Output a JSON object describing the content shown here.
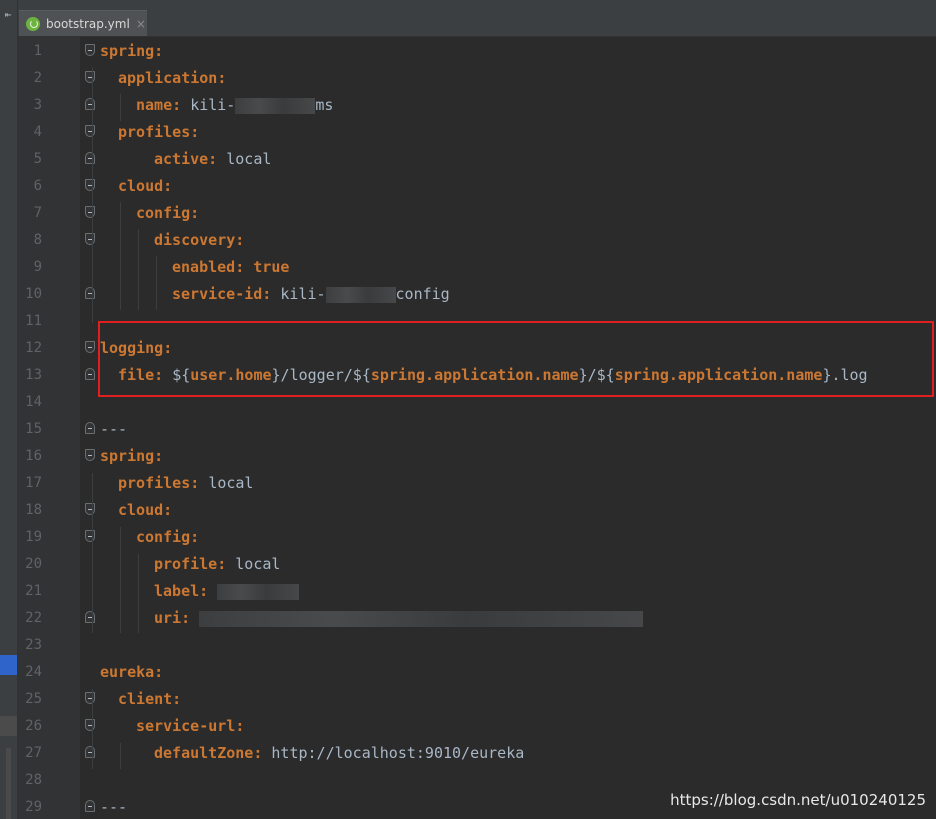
{
  "tab": {
    "filename": "bootstrap.yml",
    "close_glyph": "×",
    "icon": "spring-leaf-icon",
    "nav_glyph": "⇤"
  },
  "line_numbers": [
    "1",
    "2",
    "3",
    "4",
    "5",
    "6",
    "7",
    "8",
    "9",
    "10",
    "11",
    "12",
    "13",
    "14",
    "15",
    "16",
    "17",
    "18",
    "19",
    "20",
    "21",
    "22",
    "23",
    "24",
    "25",
    "26",
    "27",
    "28",
    "29"
  ],
  "code": {
    "l1_key": "spring:",
    "l2_key": "application:",
    "l3_key": "name:",
    "l3_val_a": "kili-",
    "l3_val_b": "ms",
    "l4_key": "profiles:",
    "l5_key": "active:",
    "l5_val": "local",
    "l6_key": "cloud:",
    "l7_key": "config:",
    "l8_key": "discovery:",
    "l9_key": "enabled:",
    "l9_val": "true",
    "l10_key": "service-id:",
    "l10_val_a": "kili-",
    "l10_val_b": "config",
    "l12_key": "logging:",
    "l13_key": "file:",
    "l13_p1": "${",
    "l13_v1": "user.home",
    "l13_p2": "}/logger/${",
    "l13_v2": "spring.application.name",
    "l13_p3": "}/${",
    "l13_v3": "spring.application.name",
    "l13_p4": "}.log",
    "l15_sep": "---",
    "l16_key": "spring:",
    "l17_key": "profiles:",
    "l17_val": "local",
    "l18_key": "cloud:",
    "l19_key": "config:",
    "l20_key": "profile:",
    "l20_val": "local",
    "l21_key": "label:",
    "l22_key": "uri:",
    "l24_key": "eureka:",
    "l25_key": "client:",
    "l26_key": "service-url:",
    "l27_key": "defaultZone:",
    "l27_val": "http://localhost:9010/eureka",
    "l29_sep": "---"
  },
  "watermark": "https://blog.csdn.net/u010240125",
  "colors": {
    "background": "#2b2b2b",
    "keyword": "#cc7832",
    "text": "#a9b7c6",
    "line_number": "#606366",
    "highlight_box": "#e02020"
  }
}
